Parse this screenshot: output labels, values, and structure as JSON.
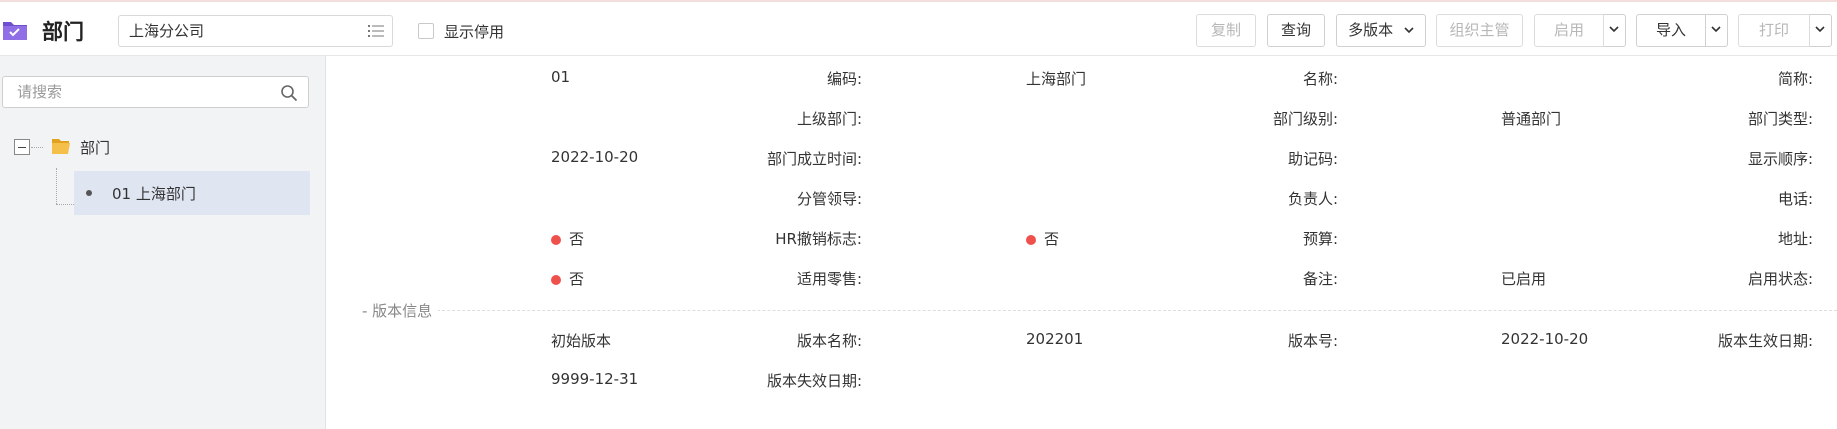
{
  "header": {
    "title": "部门",
    "org_select_value": "上海分公司",
    "show_disabled_label": "显示停用",
    "buttons": {
      "copy": "复制",
      "query": "查询",
      "multi_version": "多版本",
      "org_manager": "组织主管",
      "enable": "启用",
      "import": "导入",
      "print": "打印"
    },
    "icons": {
      "app": "app-folder-check-icon",
      "list": "list-icon",
      "caret": "chevron-down-icon"
    },
    "accent": "#7b5ad6"
  },
  "sidebar": {
    "search_placeholder": "请搜索",
    "tree": {
      "root_label": "部门",
      "children": [
        {
          "label": "01 上海部门"
        }
      ]
    },
    "selected_bg": "#dfe6f2"
  },
  "detail": {
    "fields": {
      "code_label": "编码:",
      "code_value": "01",
      "name_label": "名称:",
      "name_value": "上海部门",
      "short_label": "简称:",
      "short_value": "",
      "parent_label": "上级部门:",
      "parent_value": "",
      "level_label": "部门级别:",
      "level_value": "",
      "type_label": "部门类型:",
      "type_value": "普通部门",
      "founded_label": "部门成立时间:",
      "founded_value": "2022-10-20",
      "mnemonic_label": "助记码:",
      "mnemonic_value": "",
      "order_label": "显示顺序:",
      "order_value": "",
      "leader_label": "分管领导:",
      "leader_value": "",
      "owner_label": "负责人:",
      "owner_value": "",
      "phone_label": "电话:",
      "phone_value": "",
      "hr_revoked_label": "HR撤销标志:",
      "hr_revoked_value": "否",
      "budget_label": "预算:",
      "budget_value": "否",
      "address_label": "地址:",
      "address_value": "",
      "retail_label": "适用零售:",
      "retail_value": "否",
      "remark_label": "备注:",
      "remark_value": "",
      "status_label": "启用状态:",
      "status_value": "已启用"
    },
    "version_section": {
      "title": "- 版本信息",
      "version_name_label": "版本名称:",
      "version_name_value": "初始版本",
      "version_no_label": "版本号:",
      "version_no_value": "202201",
      "effective_label": "版本生效日期:",
      "effective_value": "2022-10-20",
      "expiry_label": "版本失效日期:",
      "expiry_value": "9999-12-31"
    },
    "flag_color": "#f0504b"
  }
}
